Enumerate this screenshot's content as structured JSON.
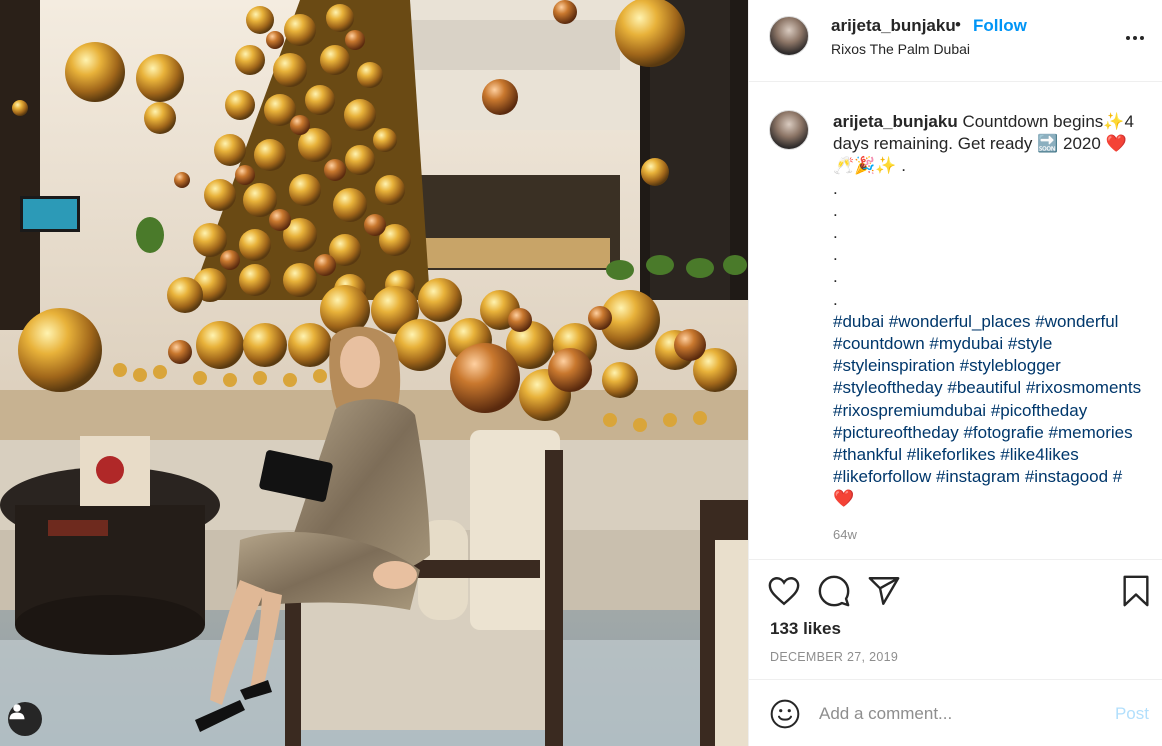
{
  "post": {
    "username": "arijeta_bunjaku",
    "separator": "•",
    "follow_label": "Follow",
    "location": "Rixos The Palm Dubai",
    "caption_text": "Countdown begins✨4 days remaining. Get ready 🔜 2020 ❤️🥂🎉✨ .",
    "caption_dots": [
      ".",
      ".",
      ".",
      ".",
      ".",
      "."
    ],
    "hashtags": [
      "#dubai",
      "#wonderful_places",
      "#wonderful",
      "#countdown",
      "#mydubai",
      "#style",
      "#styleinspiration",
      "#styleblogger",
      "#styleoftheday",
      "#beautiful",
      "#rixosmoments",
      "#rixospremiumdubai",
      "#picoftheday",
      "#pictureoftheday",
      "#fotografie",
      "#memories",
      "#thankful",
      "#likeforlikes",
      "#like4likes",
      "#likeforfollow",
      "#instagram",
      "#instagood",
      "#"
    ],
    "trailing_emoji": "❤️",
    "time_ago": "64w",
    "likes": "133 likes",
    "date": "DECEMBER 27, 2019"
  },
  "comment": {
    "placeholder": "Add a comment...",
    "post_label": "Post"
  },
  "icons": {
    "more": "more-options-icon",
    "like": "heart-icon",
    "comment": "comment-icon",
    "share": "paper-plane-icon",
    "save": "bookmark-icon",
    "emoji": "smiley-icon",
    "tagged_user": "user-silhouette-icon"
  },
  "colors": {
    "link_blue": "#0095f6",
    "hashtag_blue": "#00376b",
    "muted": "#8e8e8e",
    "post_disabled": "#b2dffc"
  }
}
